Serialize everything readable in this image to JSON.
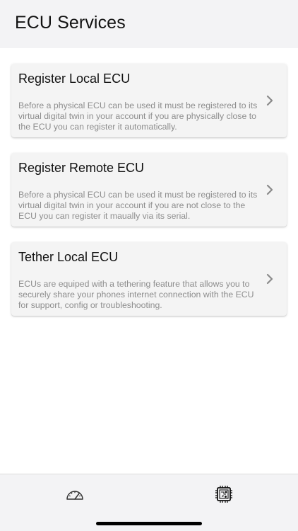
{
  "header": {
    "title": "ECU Services"
  },
  "cards": [
    {
      "title": "Register Local ECU",
      "description": "Before a physical ECU can be used it must be registered to its virtual digital twin in your account if you are physically close to the ECU you can register it automatically."
    },
    {
      "title": "Register Remote ECU",
      "description": "Before a physical ECU can be used it must be registered to its virtual digital twin in your account if you are not close to the ECU you can register it maually via its serial."
    },
    {
      "title": "Tether Local ECU",
      "description": "ECUs are equiped with a tethering feature that allows you to securely share your phones internet connection with the ECU for support, config or troubleshooting."
    }
  ],
  "tabbar": {
    "tabs": [
      {
        "icon": "speedometer-icon",
        "active": false
      },
      {
        "icon": "chip-icon",
        "active": true
      }
    ]
  },
  "colors": {
    "header_bg": "#f3f3f5",
    "card_bg": "#f4f4f4",
    "description_text": "#8d8d8d",
    "chevron": "#8a8a8a"
  }
}
